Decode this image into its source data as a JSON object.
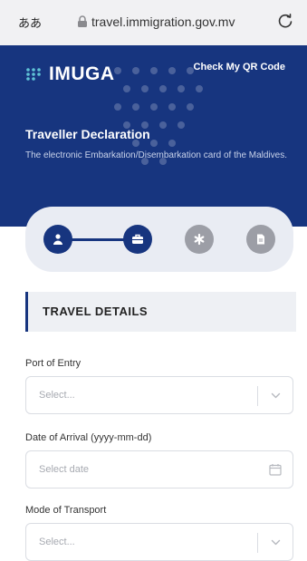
{
  "browser": {
    "text_size_button": "ああ",
    "url": "travel.immigration.gov.mv"
  },
  "header": {
    "logo_text": "IMUGA",
    "qr_link": "Check My QR Code",
    "title": "Traveller Declaration",
    "subtitle": "The electronic Embarkation/Disembarkation card of the Maldives."
  },
  "stepper": {
    "steps": [
      {
        "icon": "person-icon",
        "state": "active"
      },
      {
        "icon": "briefcase-icon",
        "state": "active"
      },
      {
        "icon": "asterisk-icon",
        "state": "pending"
      },
      {
        "icon": "document-icon",
        "state": "pending"
      }
    ]
  },
  "section": {
    "title": "TRAVEL DETAILS"
  },
  "form": {
    "port_of_entry": {
      "label": "Port of Entry",
      "placeholder": "Select..."
    },
    "date_of_arrival": {
      "label": "Date of Arrival (yyyy-mm-dd)",
      "placeholder": "Select date"
    },
    "mode_of_transport": {
      "label": "Mode of Transport",
      "placeholder": "Select..."
    }
  },
  "colors": {
    "brand_primary": "#17357f",
    "step_pending": "#9c9ea6",
    "section_bg": "#eef0f4"
  }
}
